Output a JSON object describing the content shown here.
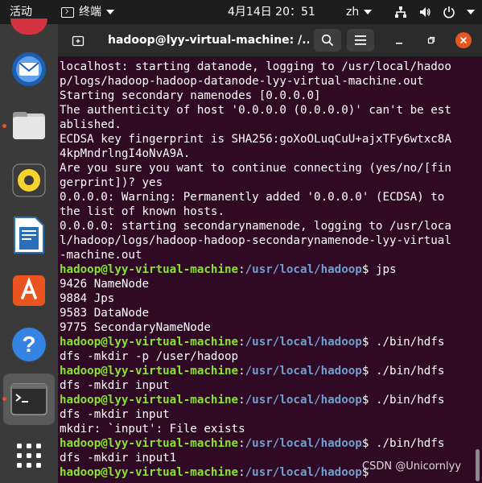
{
  "topbar": {
    "activities": "活动",
    "app_name": "终端",
    "clock": "4月14日  20：51",
    "input_method": "zh"
  },
  "window": {
    "title": "hadoop@lyy-virtual-machine: /..."
  },
  "terminal": {
    "prompt_user": "hadoop@lyy-virtual-machine",
    "prompt_sep": ":",
    "prompt_path": "/usr/local/hadoop",
    "prompt_dollar": "$ ",
    "lines": [
      "localhost: starting datanode, logging to /usr/local/hadoo",
      "p/logs/hadoop-hadoop-datanode-lyy-virtual-machine.out",
      "Starting secondary namenodes [0.0.0.0]",
      "The authenticity of host '0.0.0.0 (0.0.0.0)' can't be est",
      "ablished.",
      "ECDSA key fingerprint is SHA256:goXoOLuqCuU+ajxTFy6wtxc8A",
      "4kpMndrlngI4oNvA9A.",
      "Are you sure you want to continue connecting (yes/no/[fin",
      "gerprint])? yes",
      "0.0.0.0: Warning: Permanently added '0.0.0.0' (ECDSA) to",
      "the list of known hosts.",
      "0.0.0.0: starting secondarynamenode, logging to /usr/loca",
      "l/hadoop/logs/hadoop-hadoop-secondarynamenode-lyy-virtual",
      "-machine.out",
      "",
      "9426 NameNode",
      "9884 Jps",
      "9583 DataNode",
      "9775 SecondaryNameNode",
      "",
      "dfs -mkdir -p /user/hadoop",
      "",
      "dfs -mkdir input",
      "",
      "dfs -mkdir input",
      "mkdir: `input': File exists",
      "",
      "dfs -mkdir input1",
      ""
    ],
    "commands": {
      "c1": "jps",
      "c2": "./bin/hdfs",
      "c3": "./bin/hdfs",
      "c4": "./bin/hdfs",
      "c5": "./bin/hdfs"
    }
  },
  "watermark": "CSDN @Unicornlyy",
  "colors": {
    "terminal_bg": "#300a24",
    "prompt_user": "#8ae234",
    "prompt_path": "#729fcf",
    "accent": "#e95420"
  },
  "dock_icons": [
    "thunderbird-icon",
    "files-icon",
    "rhythmbox-icon",
    "libreoffice-writer-icon",
    "ubuntu-software-icon",
    "help-icon",
    "terminal-icon",
    "show-apps-icon"
  ]
}
